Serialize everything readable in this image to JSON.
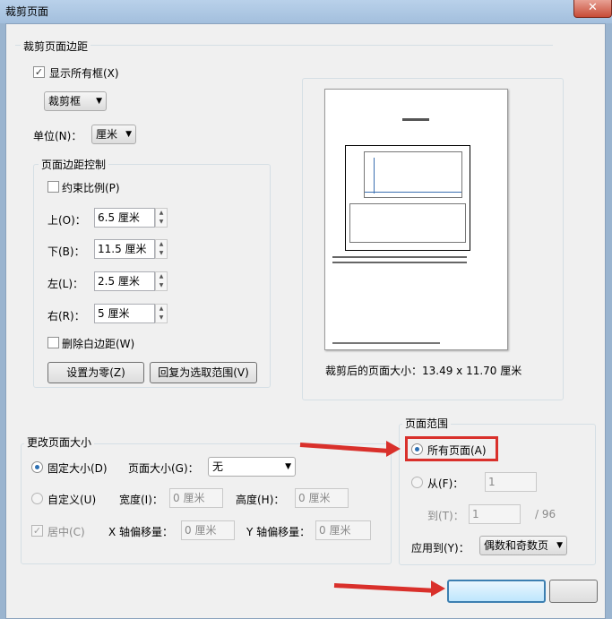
{
  "window": {
    "title": "裁剪页面",
    "close_glyph": "✕"
  },
  "margins": {
    "group_title": "裁剪页面边距",
    "show_all_boxes": "显示所有框(X)",
    "box_type": "裁剪框",
    "unit_label": "单位(N)：",
    "unit_value": "厘米",
    "control_title": "页面边距控制",
    "constrain": "约束比例(P)",
    "top_label": "上(O)：",
    "top_value": "6.5 厘米",
    "bottom_label": "下(B)：",
    "bottom_value": "11.5 厘米",
    "left_label": "左(L)：",
    "left_value": "2.5 厘米",
    "right_label": "右(R)：",
    "right_value": "5 厘米",
    "remove_white": "删除白边距(W)",
    "zero_button": "设置为零(Z)",
    "revert_button": "回复为选取范围(V)"
  },
  "preview": {
    "caption": "裁剪后的页面大小：13.49 x 11.70 厘米"
  },
  "change_size": {
    "group_title": "更改页面大小",
    "fixed": "固定大小(D)",
    "page_size_label": "页面大小(G)：",
    "page_size_value": "无",
    "custom": "自定义(U)",
    "width_label": "宽度(I)：",
    "width_value": "0 厘米",
    "height_label": "高度(H)：",
    "height_value": "0 厘米",
    "center": "居中(C)",
    "x_offset_label": "X 轴偏移量：",
    "x_offset_value": "0 厘米",
    "y_offset_label": "Y 轴偏移量：",
    "y_offset_value": "0 厘米"
  },
  "page_range": {
    "group_title": "页面范围",
    "all_pages": "所有页面(A)",
    "from_label": "从(F)：",
    "from_value": "1",
    "to_label": "到(T)：",
    "to_value": "1",
    "total": "/ 96",
    "apply_label": "应用到(Y)：",
    "apply_value": "偶数和奇数页"
  },
  "annotation": {
    "color": "#d9302b"
  }
}
